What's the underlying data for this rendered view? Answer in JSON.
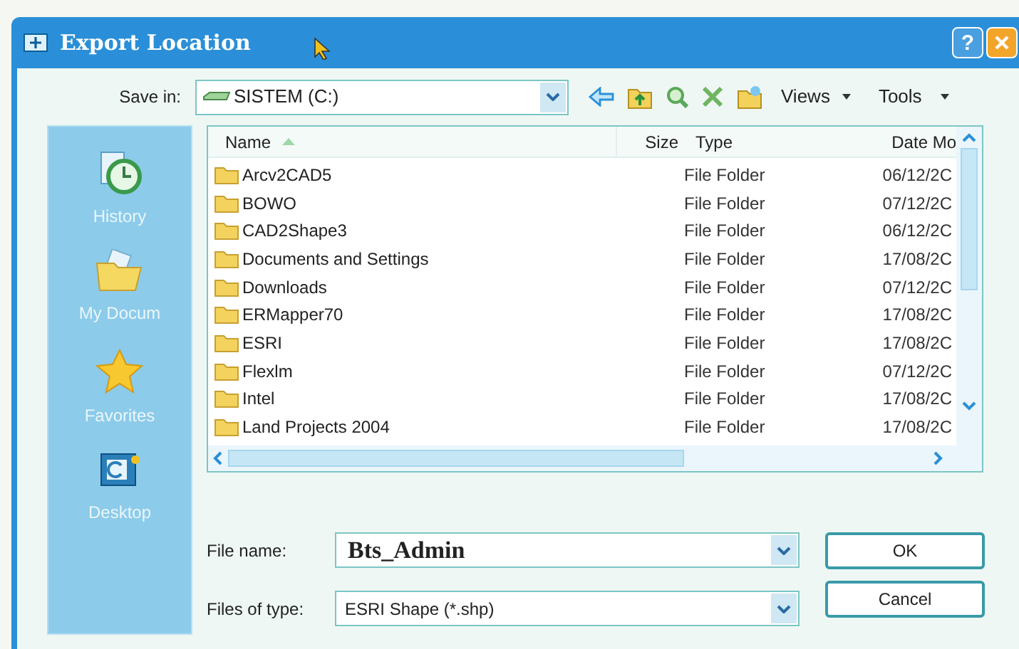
{
  "window": {
    "title": "Export Location",
    "help_button": "?"
  },
  "save_in": {
    "label": "Save in:",
    "value": "SISTEM (C:)"
  },
  "toolbar": {
    "views": "Views",
    "tools": "Tools"
  },
  "sidebar": {
    "items": [
      {
        "label": "History",
        "kind": "history"
      },
      {
        "label": "My Docum",
        "kind": "documents"
      },
      {
        "label": "Favorites",
        "kind": "favorites"
      },
      {
        "label": "Desktop",
        "kind": "desktop"
      }
    ]
  },
  "file_list": {
    "columns": [
      {
        "label": "Name",
        "sorted": true
      },
      {
        "label": "Size",
        "sorted": false
      },
      {
        "label": "Type",
        "sorted": false
      },
      {
        "label": "Date Mo",
        "sorted": false
      }
    ],
    "rows": [
      {
        "name": "Arcv2CAD5",
        "type": "File Folder",
        "date": "06/12/2C"
      },
      {
        "name": "BOWO",
        "type": "File Folder",
        "date": "07/12/2C"
      },
      {
        "name": "CAD2Shape3",
        "type": "File Folder",
        "date": "06/12/2C"
      },
      {
        "name": "Documents and Settings",
        "type": "File Folder",
        "date": "17/08/2C"
      },
      {
        "name": "Downloads",
        "type": "File Folder",
        "date": "07/12/2C"
      },
      {
        "name": "ERMapper70",
        "type": "File Folder",
        "date": "17/08/2C"
      },
      {
        "name": "ESRI",
        "type": "File Folder",
        "date": "17/08/2C"
      },
      {
        "name": "Flexlm",
        "type": "File Folder",
        "date": "07/12/2C"
      },
      {
        "name": "Intel",
        "type": "File Folder",
        "date": "17/08/2C"
      },
      {
        "name": "Land Projects 2004",
        "type": "File Folder",
        "date": "17/08/2C"
      }
    ]
  },
  "file_name": {
    "label": "File name:",
    "value": "Bts_Admin"
  },
  "file_type": {
    "label": "Files of type:",
    "value": "ESRI Shape (*.shp)"
  },
  "buttons": [
    {
      "label": "OK"
    },
    {
      "label": "Cancel"
    }
  ]
}
